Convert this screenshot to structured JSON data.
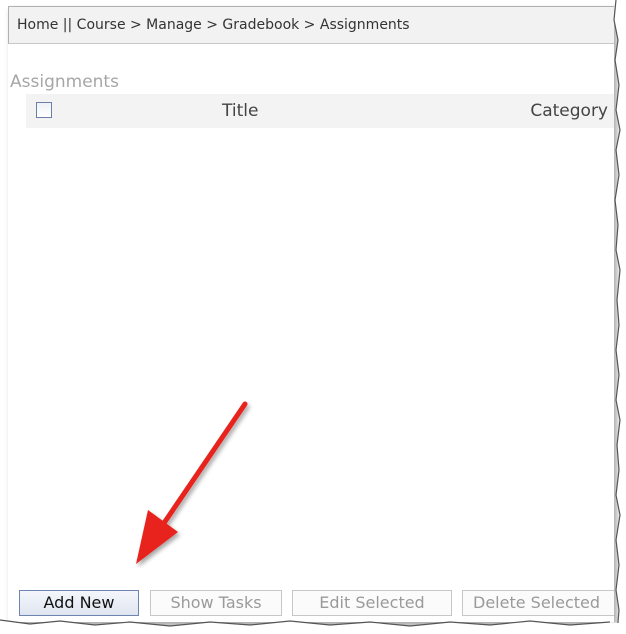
{
  "breadcrumb": {
    "text": "Home || Course > Manage > Gradebook > Assignments"
  },
  "section": {
    "title": "Assignments"
  },
  "table": {
    "columns": [
      "Title",
      "Category"
    ],
    "rows": []
  },
  "buttons": {
    "add_new": "Add New",
    "show_tasks": "Show Tasks",
    "edit_selected": "Edit Selected",
    "delete_selected": "Delete Selected"
  },
  "annotation": {
    "arrow_color": "#e8201c",
    "points_to": "add-new-button"
  },
  "colors": {
    "header_bg": "#f2f2f2",
    "table_header_bg": "#f3f3f3",
    "primary_button_border": "#6f84b2",
    "disabled_text": "#9a9a9a"
  }
}
